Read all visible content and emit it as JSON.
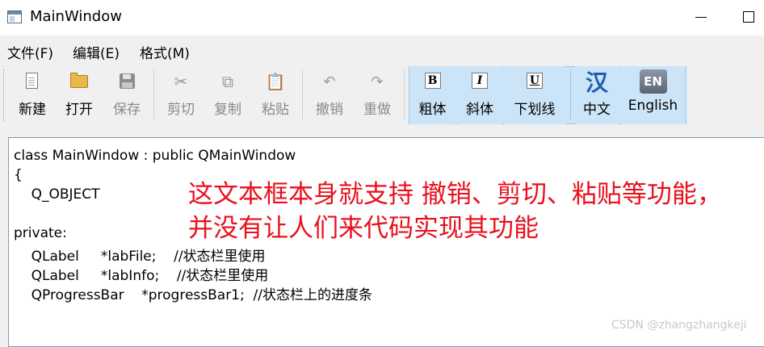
{
  "window": {
    "title": "MainWindow",
    "app_icon": "window-app-icon",
    "controls": [
      "minimize-icon",
      "maximize-icon"
    ]
  },
  "menubar": {
    "items": [
      {
        "label": "文件(F)"
      },
      {
        "label": "编辑(E)"
      },
      {
        "label": "格式(M)"
      }
    ]
  },
  "toolbar": {
    "buttons": [
      {
        "label": "新建",
        "icon": "new-file-icon",
        "enabled": true
      },
      {
        "label": "打开",
        "icon": "open-folder-icon",
        "enabled": true
      },
      {
        "label": "保存",
        "icon": "save-icon",
        "enabled": false
      },
      {
        "label": "剪切",
        "icon": "cut-icon",
        "enabled": false
      },
      {
        "label": "复制",
        "icon": "copy-icon",
        "enabled": false
      },
      {
        "label": "粘贴",
        "icon": "paste-icon",
        "enabled": false
      },
      {
        "label": "撤销",
        "icon": "undo-icon",
        "enabled": false
      },
      {
        "label": "重做",
        "icon": "redo-icon",
        "enabled": false
      },
      {
        "label": "粗体",
        "icon": "bold-icon",
        "glyph": "B",
        "checked": true
      },
      {
        "label": "斜体",
        "icon": "italic-icon",
        "glyph": "I",
        "checked": true
      },
      {
        "label": "下划线",
        "icon": "underline-icon",
        "glyph": "U",
        "checked": true
      },
      {
        "label": "中文",
        "icon": "chinese-language-icon",
        "glyph": "汉",
        "checked": true
      },
      {
        "label": "English",
        "icon": "english-language-icon",
        "glyph": "EN",
        "checked": true
      }
    ],
    "checked_color": "#cce4f7"
  },
  "editor": {
    "lines": [
      "class MainWindow : public QMainWindow",
      "{",
      "    Q_OBJECT",
      "",
      "private:",
      "    QLabel     *labFile;    //状态栏里使用",
      "    QLabel     *labInfo;    //状态栏里使用",
      "    QProgressBar    *progressBar1;  //状态栏上的进度条"
    ],
    "annotation": [
      "这文本框本身就支持 撤销、剪切、粘贴等功能，",
      "并没有让人们来代码实现其功能"
    ],
    "annotation_color": "#e8101c"
  },
  "watermark": "CSDN @zhangzhangkeji"
}
